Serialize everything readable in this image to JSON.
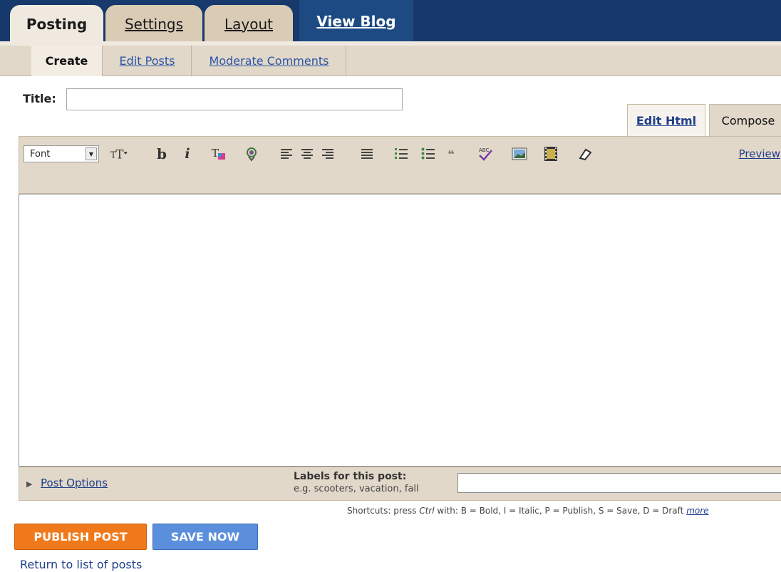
{
  "top_tabs": {
    "posting": "Posting",
    "settings": "Settings",
    "layout": "Layout",
    "view_blog": "View Blog"
  },
  "sub_tabs": {
    "create": "Create",
    "edit_posts": "Edit Posts",
    "moderate_comments": "Moderate Comments"
  },
  "title_field": {
    "label": "Title:",
    "value": ""
  },
  "editor_modes": {
    "edit_html": "Edit Html",
    "compose": "Compose"
  },
  "toolbar": {
    "font_select": "Font",
    "preview": "Preview",
    "icons": [
      "font-size-icon",
      "bold-icon",
      "italic-icon",
      "text-color-icon",
      "link-icon",
      "align-left-icon",
      "align-center-icon",
      "align-right-icon",
      "justify-icon",
      "numbered-list-icon",
      "bullet-list-icon",
      "blockquote-icon",
      "spellcheck-icon",
      "image-icon",
      "video-icon",
      "eraser-icon"
    ]
  },
  "editor": {
    "content": ""
  },
  "options": {
    "post_options": "Post Options",
    "labels_title": "Labels for this post:",
    "labels_hint": "e.g. scooters, vacation, fall",
    "labels_value": ""
  },
  "shortcuts": {
    "prefix": "Shortcuts: press ",
    "ctrl": "Ctrl",
    "mid": " with: ",
    "text": "B = Bold, I = Italic, P = Publish, S = Save, D = Draft ",
    "more": "more"
  },
  "buttons": {
    "publish": "PUBLISH POST",
    "save": "SAVE NOW"
  },
  "return_link": "Return to list of posts",
  "colors": {
    "nav_blue": "#17396b",
    "tan": "#e2d8c9",
    "publish_orange": "#f07a1b",
    "save_blue": "#5b8fdc"
  }
}
